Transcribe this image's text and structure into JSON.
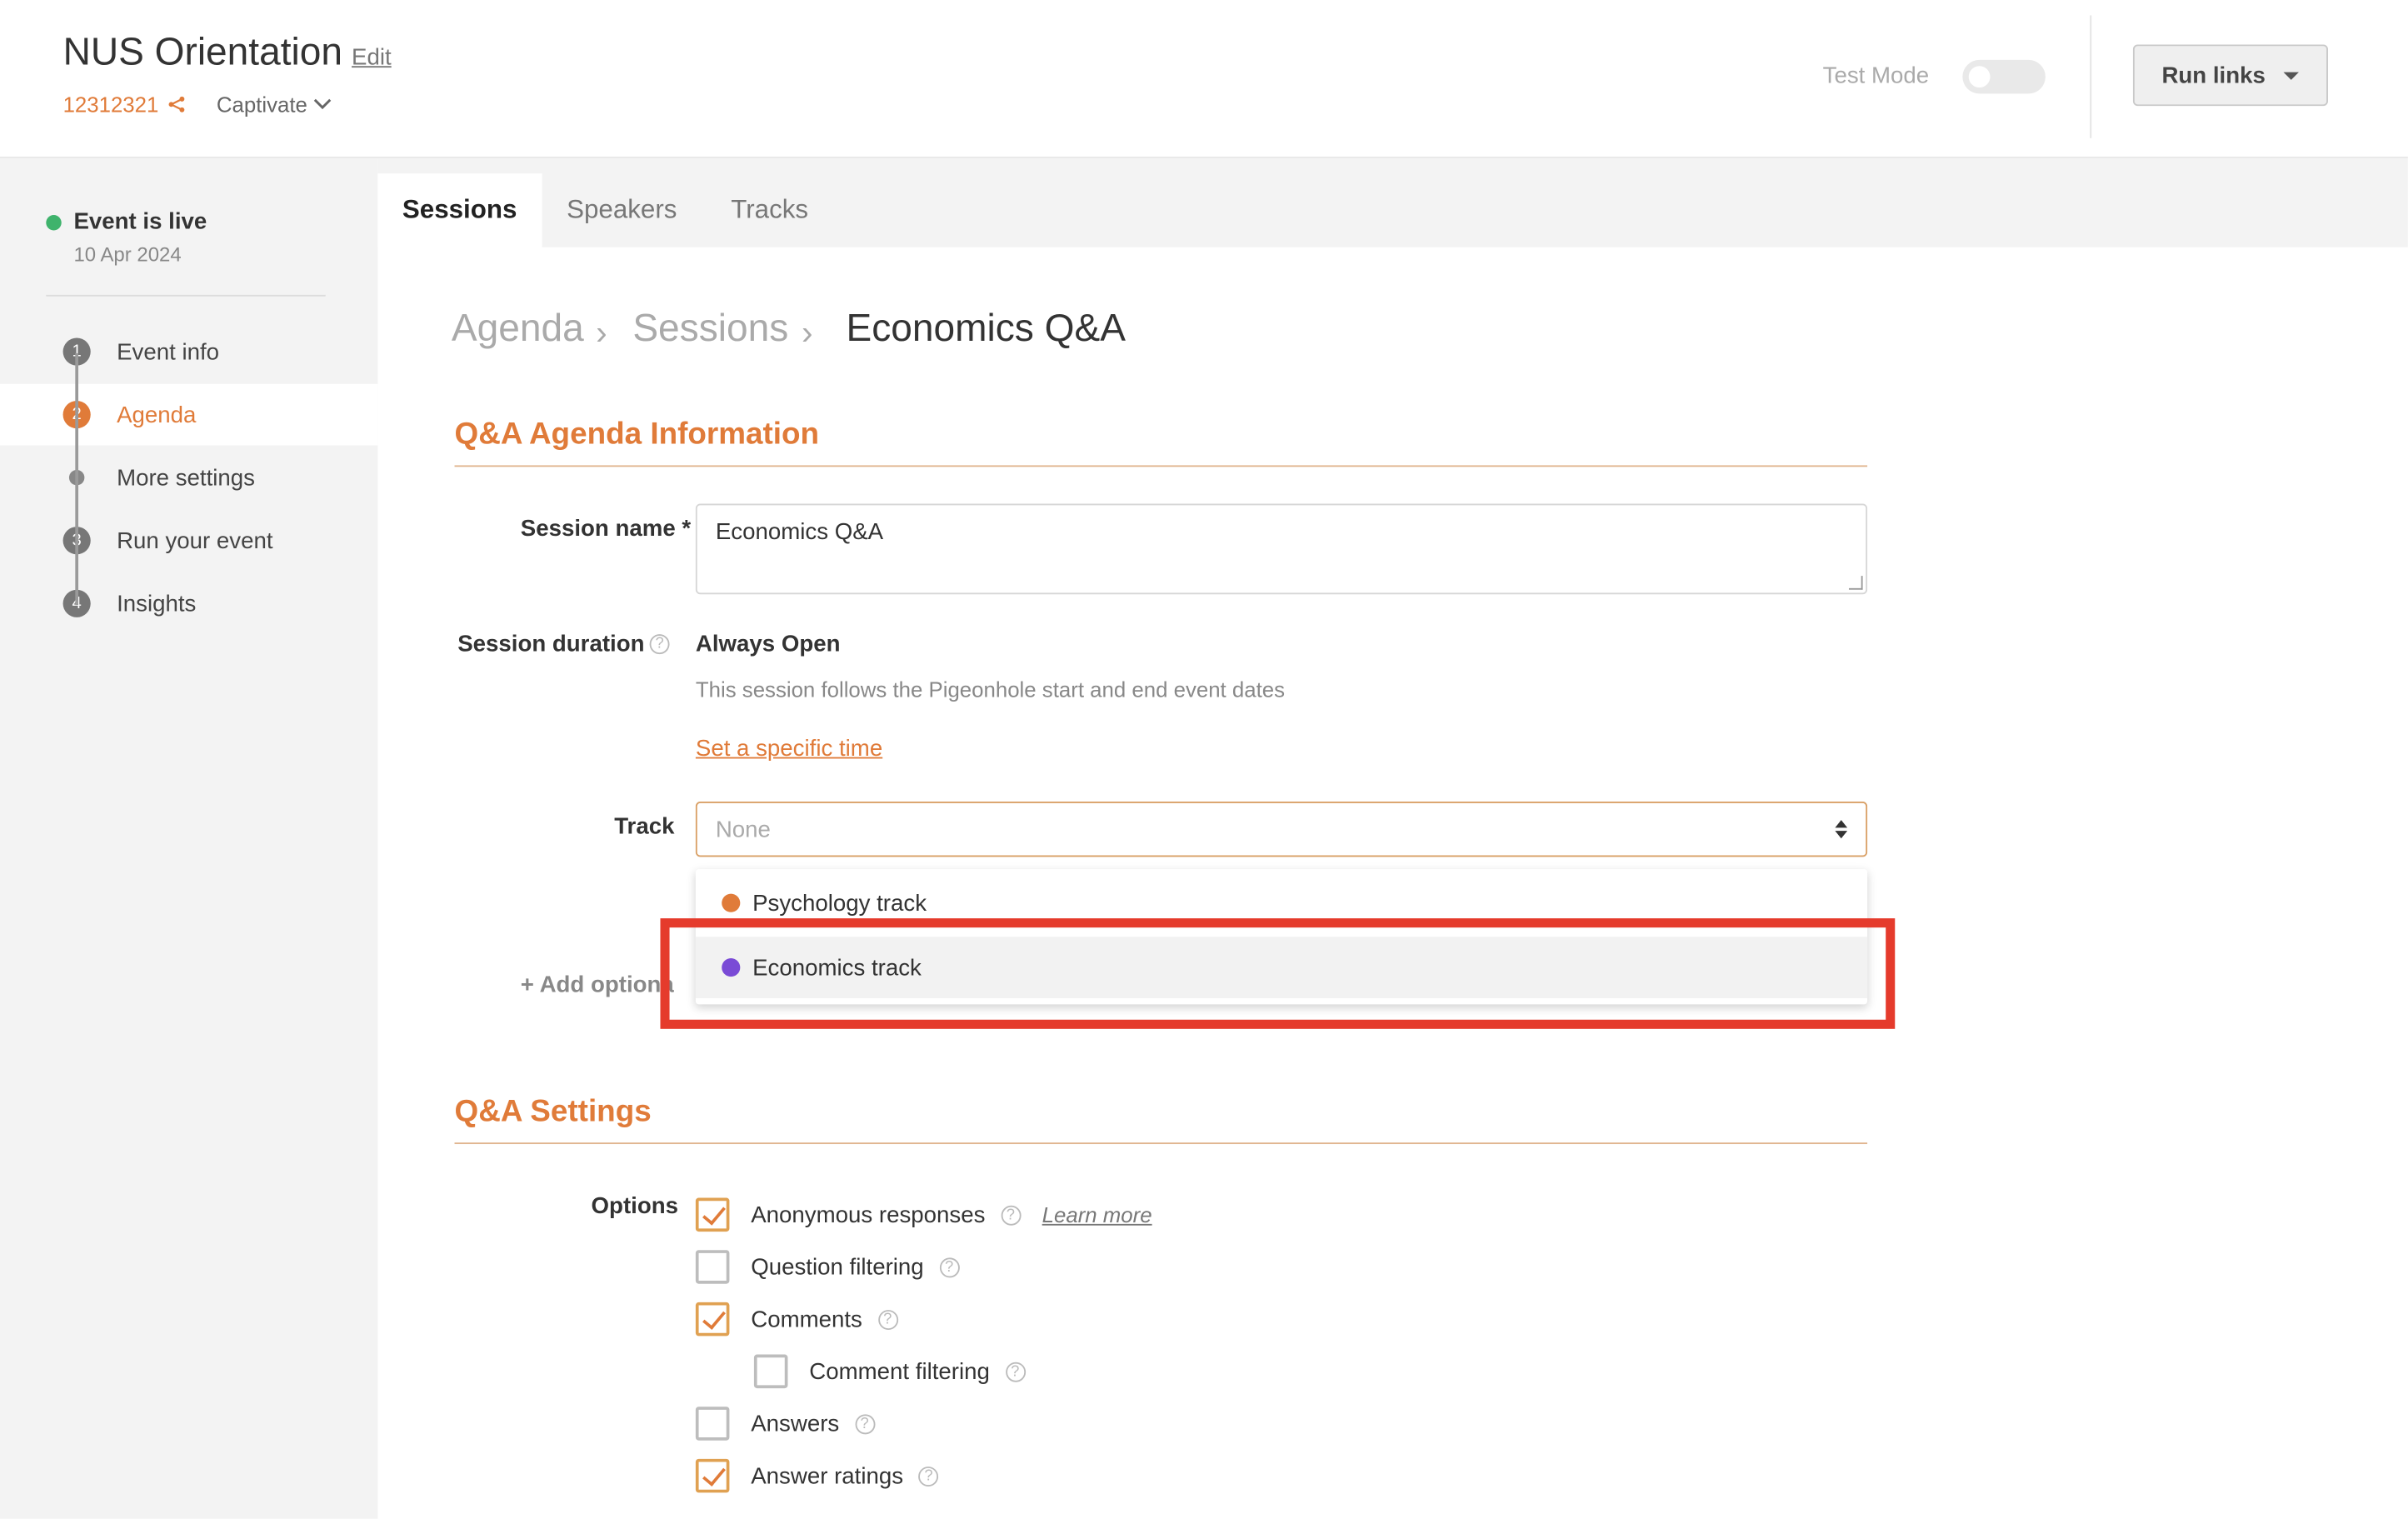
{
  "header": {
    "title": "NUS Orientation",
    "edit_label": "Edit",
    "event_code": "12312321",
    "product": "Captivate",
    "test_mode_label": "Test Mode",
    "run_links_label": "Run links"
  },
  "sidebar": {
    "status": "Event is live",
    "date": "10 Apr 2024",
    "items": [
      {
        "step": "1",
        "label": "Event info"
      },
      {
        "step": "2",
        "label": "Agenda"
      },
      {
        "step": "",
        "label": "More settings"
      },
      {
        "step": "3",
        "label": "Run your event"
      },
      {
        "step": "4",
        "label": "Insights"
      }
    ]
  },
  "tabs": [
    "Sessions",
    "Speakers",
    "Tracks"
  ],
  "breadcrumb": [
    "Agenda",
    "Sessions",
    "Economics Q&A"
  ],
  "info_section": {
    "title": "Q&A Agenda Information",
    "session_name_label": "Session name *",
    "session_name_value": "Economics Q&A",
    "duration_label": "Session duration",
    "duration_value": "Always Open",
    "duration_desc": "This session follows the Pigeonhole start and end event dates",
    "set_time_link": "Set a specific time",
    "track_label": "Track",
    "track_placeholder": "None",
    "add_optional": "+ Add optional",
    "track_options": [
      {
        "label": "Psychology track",
        "color": "#e07b39"
      },
      {
        "label": "Economics track",
        "color": "#7a4bd6"
      }
    ]
  },
  "settings_section": {
    "title": "Q&A Settings",
    "options_label": "Options",
    "learn_more": "Learn more",
    "options": [
      {
        "label": "Anonymous responses",
        "checked": true
      },
      {
        "label": "Question filtering",
        "checked": false
      },
      {
        "label": "Comments",
        "checked": true
      },
      {
        "label": "Comment filtering",
        "checked": false
      },
      {
        "label": "Answers",
        "checked": false
      },
      {
        "label": "Answer ratings",
        "checked": true
      }
    ]
  },
  "colors": {
    "accent": "#e07b39",
    "live": "#3fb36c",
    "highlight": "#e53b2c"
  }
}
